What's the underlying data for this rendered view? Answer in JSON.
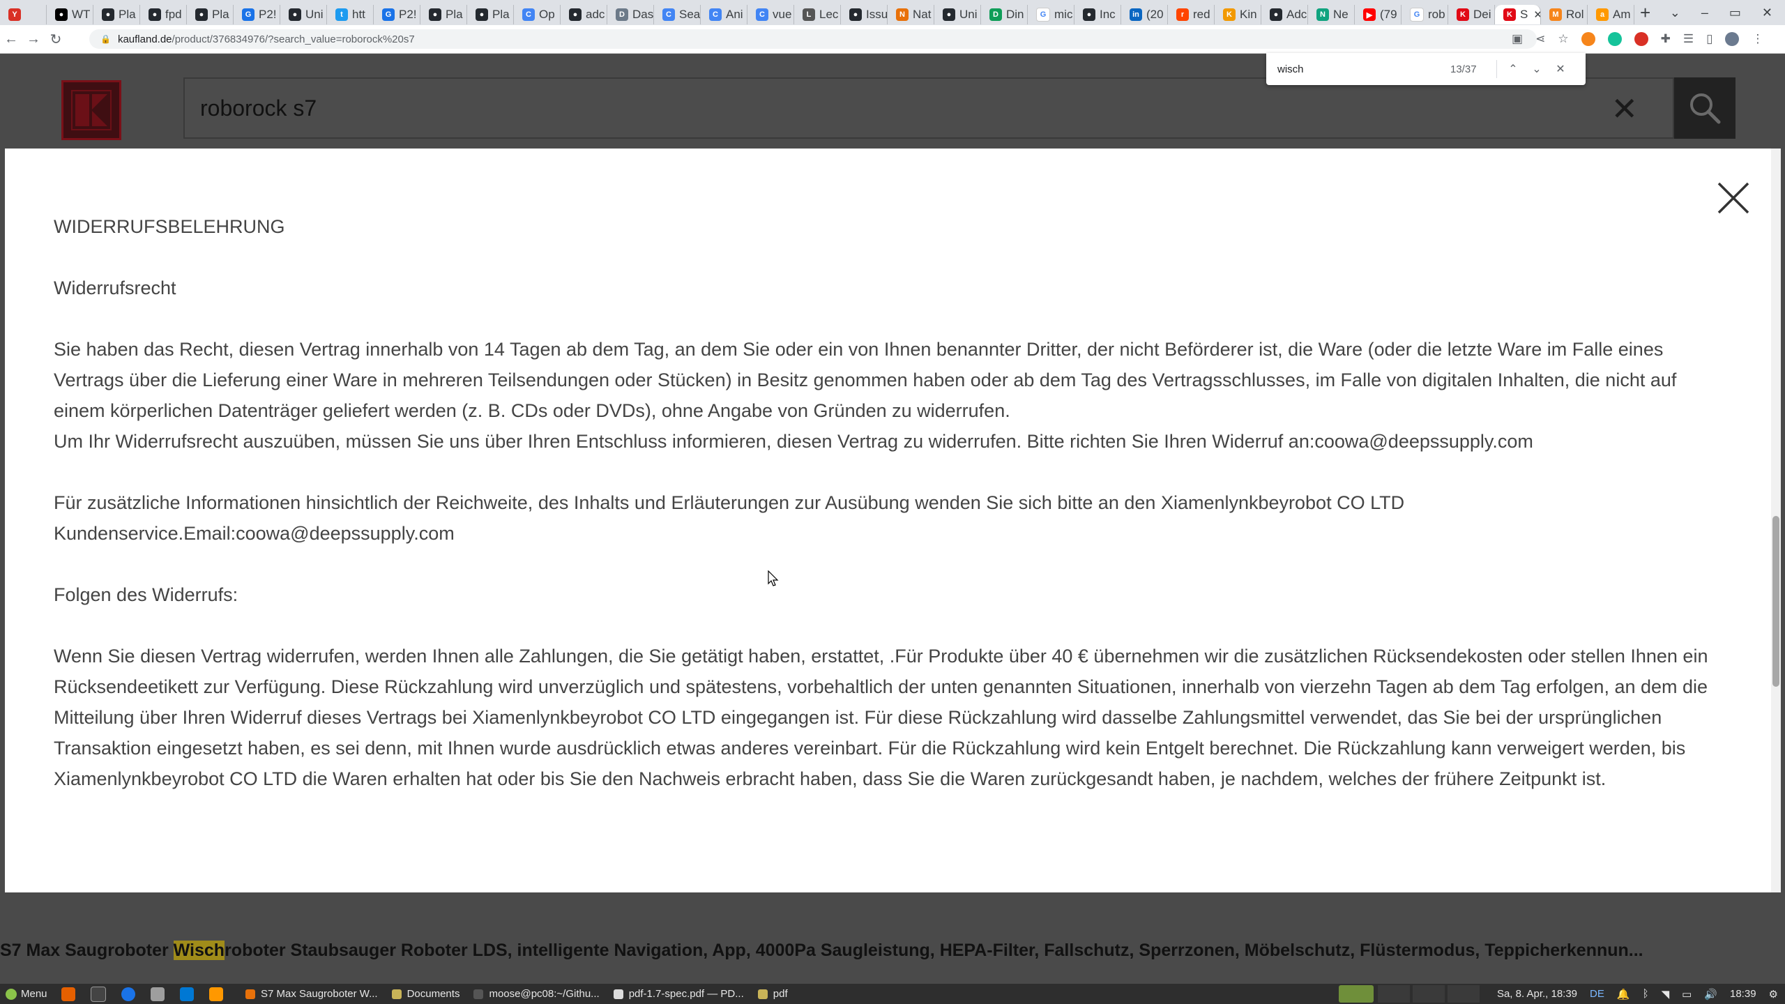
{
  "browser": {
    "tabs": [
      {
        "label": "",
        "favicon_color": "#d93025",
        "favicon_glyph": "Y"
      },
      {
        "label": "WT",
        "favicon_color": "#000000",
        "favicon_glyph": "●"
      },
      {
        "label": "Pla",
        "favicon_color": "#24292f",
        "favicon_glyph": "●"
      },
      {
        "label": "fpd",
        "favicon_color": "#24292f",
        "favicon_glyph": "●"
      },
      {
        "label": "Pla",
        "favicon_color": "#24292f",
        "favicon_glyph": "●"
      },
      {
        "label": "P2!",
        "favicon_color": "#1a73e8",
        "favicon_glyph": "G"
      },
      {
        "label": "Uni",
        "favicon_color": "#24292f",
        "favicon_glyph": "●"
      },
      {
        "label": "htt",
        "favicon_color": "#1d9bf0",
        "favicon_glyph": "t"
      },
      {
        "label": "P2!",
        "favicon_color": "#1a73e8",
        "favicon_glyph": "G"
      },
      {
        "label": "Pla",
        "favicon_color": "#24292f",
        "favicon_glyph": "●"
      },
      {
        "label": "Pla",
        "favicon_color": "#24292f",
        "favicon_glyph": "●"
      },
      {
        "label": "Op",
        "favicon_color": "#4285f4",
        "favicon_glyph": "C"
      },
      {
        "label": "adc",
        "favicon_color": "#24292f",
        "favicon_glyph": "●"
      },
      {
        "label": "Das",
        "favicon_color": "#6c7a89",
        "favicon_glyph": "D"
      },
      {
        "label": "Sea",
        "favicon_color": "#4285f4",
        "favicon_glyph": "C"
      },
      {
        "label": "Ani",
        "favicon_color": "#4285f4",
        "favicon_glyph": "C"
      },
      {
        "label": "vue",
        "favicon_color": "#4285f4",
        "favicon_glyph": "C"
      },
      {
        "label": "Lec",
        "favicon_color": "#555555",
        "favicon_glyph": "L"
      },
      {
        "label": "Issu",
        "favicon_color": "#24292f",
        "favicon_glyph": "●"
      },
      {
        "label": "Nat",
        "favicon_color": "#e8710a",
        "favicon_glyph": "N"
      },
      {
        "label": "Uni",
        "favicon_color": "#24292f",
        "favicon_glyph": "●"
      },
      {
        "label": "Din",
        "favicon_color": "#0f9d58",
        "favicon_glyph": "D"
      },
      {
        "label": "mic",
        "favicon_color": "#ffffff",
        "favicon_glyph": "G"
      },
      {
        "label": "Inc",
        "favicon_color": "#24292f",
        "favicon_glyph": "●"
      },
      {
        "label": "(20",
        "favicon_color": "#0a66c2",
        "favicon_glyph": "in"
      },
      {
        "label": "red",
        "favicon_color": "#ff4500",
        "favicon_glyph": "r"
      },
      {
        "label": "Kin",
        "favicon_color": "#f29900",
        "favicon_glyph": "K"
      },
      {
        "label": "Adc",
        "favicon_color": "#24292f",
        "favicon_glyph": "●"
      },
      {
        "label": "Ne",
        "favicon_color": "#10a37f",
        "favicon_glyph": "N"
      },
      {
        "label": "(79",
        "favicon_color": "#ff0000",
        "favicon_glyph": "▶"
      },
      {
        "label": "rob",
        "favicon_color": "#ffffff",
        "favicon_glyph": "G"
      },
      {
        "label": "Dei",
        "favicon_color": "#e10915",
        "favicon_glyph": "K"
      },
      {
        "label": "S",
        "favicon_color": "#e10915",
        "favicon_glyph": "K",
        "active": true
      },
      {
        "label": "Rol",
        "favicon_color": "#f6851b",
        "favicon_glyph": "M"
      },
      {
        "label": "Am",
        "favicon_color": "#ff9900",
        "favicon_glyph": "a"
      }
    ],
    "tab_close_glyph": "✕",
    "new_tab_glyph": "+",
    "window_controls": [
      "⌄",
      "–",
      "▭",
      "✕"
    ],
    "url_host": "kaufland.de",
    "url_path": "/product/376834976/?search_value=roborock%20s7",
    "nav": {
      "back": "←",
      "forward": "→",
      "reload": "↻"
    }
  },
  "find_bar": {
    "query": "wisch",
    "count": "13/37",
    "prev": "⌃",
    "next": "⌄",
    "close": "✕"
  },
  "site": {
    "search_value": "roborock s7",
    "clear_glyph": "✕",
    "brand_color": "#e10915",
    "product_title_lead": "S7 Max Saugroboter ",
    "product_title_highlight": "Wisch",
    "product_title_rest": "roboter Staubsauger Roboter LDS, intelligente Navigation, App, 4000Pa Saugleistung, HEPA-Filter, Fallschutz, Sperrzonen, Möbelschutz, Flüstermodus, Teppicherkennun..."
  },
  "modal": {
    "heading": "WIDERRUFSBELEHRUNG",
    "subheading": "Widerrufsrecht",
    "p1": "Sie haben das Recht, diesen Vertrag innerhalb von 14 Tagen ab dem Tag, an dem Sie oder ein von Ihnen benannter Dritter, der nicht Beförderer ist, die Ware (oder die letzte Ware im Falle eines Vertrags über die Lieferung einer Ware in mehreren Teilsendungen oder Stücken) in Besitz genommen haben oder ab dem Tag des Vertragsschlusses, im Falle von digitalen Inhalten, die nicht auf einem körperlichen Datenträger geliefert werden (z. B. CDs oder DVDs), ohne Angabe von Gründen zu widerrufen.",
    "p2": "Um Ihr Widerrufsrecht auszuüben, müssen Sie uns über Ihren Entschluss informieren, diesen Vertrag zu widerrufen. Bitte richten Sie Ihren Widerruf an:coowa@deepssupply.com",
    "p3": "Für zusätzliche Informationen hinsichtlich der Reichweite, des Inhalts und Erläuterungen zur Ausübung wenden Sie sich bitte an den Xiamenlynkbeyrobot CO LTD",
    "p4": "Kundenservice.Email:coowa@deepssupply.com",
    "p5": "Folgen des Widerrufs:",
    "p6": "Wenn Sie diesen Vertrag widerrufen, werden Ihnen alle Zahlungen, die Sie getätigt haben, erstattet, .Für Produkte über 40 € übernehmen wir die zusätzlichen Rücksendekosten oder stellen Ihnen ein Rücksendeetikett zur Verfügung. Diese Rückzahlung wird unverzüglich und spätestens, vorbehaltlich der unten genannten Situationen, innerhalb von vierzehn Tagen ab dem Tag erfolgen, an dem die Mitteilung über Ihren Widerruf dieses Vertrags bei Xiamenlynkbeyrobot CO LTD eingegangen ist. Für diese Rückzahlung wird dasselbe Zahlungsmittel verwendet, das Sie bei der ursprünglichen Transaktion eingesetzt haben, es sei denn, mit Ihnen wurde ausdrücklich etwas anderes vereinbart. Für die Rückzahlung wird kein Entgelt berechnet. Die Rückzahlung kann verweigert werden, bis Xiamenlynkbeyrobot CO LTD die Waren erhalten hat oder bis Sie den Nachweis erbracht haben, dass Sie die Waren zurückgesandt haben, je nachdem, welches der frühere Zeitpunkt ist."
  },
  "taskbar": {
    "menu_label": "Menu",
    "windows": [
      {
        "label": "S7 Max Saugroboter W...",
        "icon_color": "#e8710a"
      },
      {
        "label": "Documents",
        "icon_color": "#c9b458"
      },
      {
        "label": "moose@pc08:~/Githu...",
        "icon_color": "#555555"
      },
      {
        "label": "pdf-1.7-spec.pdf — PD...",
        "icon_color": "#dddddd"
      },
      {
        "label": "pdf",
        "icon_color": "#c9b458"
      }
    ],
    "lang": "DE",
    "date": "Sa, 8. Apr., 18:39",
    "time": "18:39"
  }
}
